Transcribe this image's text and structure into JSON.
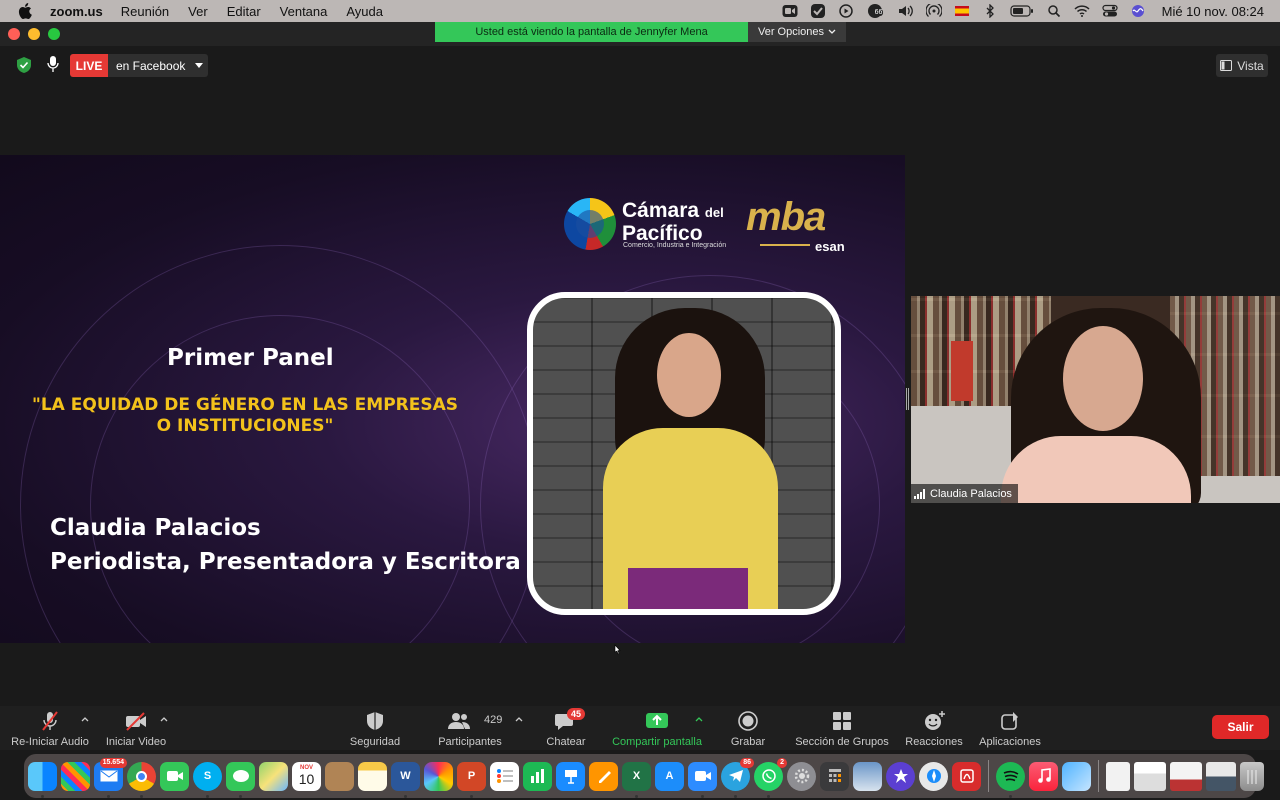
{
  "menubar": {
    "app_name": "zoom.us",
    "menus": [
      "Reunión",
      "Ver",
      "Editar",
      "Ventana",
      "Ayuda"
    ],
    "clock": "Mié 10 nov.  08:24",
    "icons": [
      "zoom-menubar-icon",
      "check-icon",
      "play-circle-icon",
      "mail-counter-icon",
      "volume-icon",
      "airdrop-icon",
      "spanish-flag-icon",
      "bluetooth-icon",
      "battery-icon",
      "search-icon",
      "wifi-icon",
      "control-center-icon",
      "siri-icon"
    ],
    "mail_counter": "66"
  },
  "window": {
    "share_banner": "Usted está viendo la pantalla de Jennyfer Mena",
    "view_options": "Ver Opciones",
    "live_badge": "LIVE",
    "live_destination": "en Facebook",
    "view_button": "Vista"
  },
  "slide": {
    "logo_camara_line1": "Cámara",
    "logo_camara_del": "del",
    "logo_camara_line2": "Pacífico",
    "logo_tagline": "Comercio, Industria e Integración",
    "logo_mba": "mba",
    "logo_esan": "esan",
    "title": "Primer Panel",
    "subtitle": "\"LA EQUIDAD DE GÉNERO EN LAS EMPRESAS O INSTITUCIONES\"",
    "speaker_name": "Claudia Palacios",
    "speaker_role": "Periodista,  Presentadora y Escritora"
  },
  "participant": {
    "name": "Claudia Palacios"
  },
  "toolbar": {
    "audio": "Re-Iniciar Audio",
    "video": "Iniciar Video",
    "security": "Seguridad",
    "participants": "Participantes",
    "participants_count": "429",
    "chat": "Chatear",
    "chat_badge": "45",
    "share": "Compartir pantalla",
    "record": "Grabar",
    "breakout": "Sección de Grupos",
    "reactions": "Reacciones",
    "apps": "Aplicaciones",
    "leave": "Salir"
  },
  "dock": {
    "mail_badge": "15.654",
    "calendar_day": "10",
    "calendar_month": "NOV",
    "telegram_badge": "86",
    "whatsapp_badge": "2",
    "apps": [
      "finder",
      "launchpad",
      "mail",
      "chrome",
      "facetime",
      "skype",
      "messages",
      "maps",
      "calendar",
      "contacts",
      "notes",
      "word",
      "photos",
      "powerpoint",
      "reminders",
      "numbers",
      "keynote",
      "pages",
      "excel",
      "app-store",
      "zoom",
      "telegram",
      "whatsapp",
      "system-preferences",
      "calculator",
      "preview",
      "imovie",
      "safari-alt",
      "acrobat",
      "spotify",
      "music",
      "photo-tool",
      "document",
      "screenshot-1",
      "screenshot-2",
      "screenshot-3",
      "trash"
    ]
  },
  "colors": {
    "accent_green": "#34c759",
    "live_red": "#e53935",
    "leave_red": "#e02828",
    "slide_yellow": "#f3c21b",
    "mba_gold": "#d9b24c"
  }
}
